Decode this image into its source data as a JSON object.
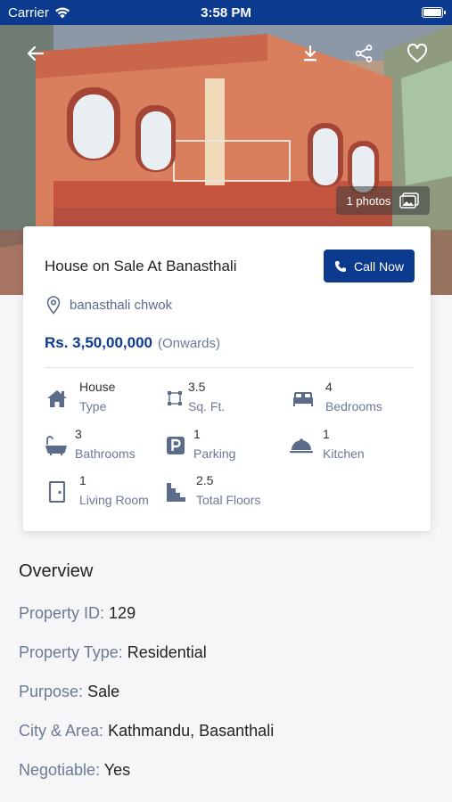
{
  "status_bar": {
    "carrier": "Carrier",
    "time": "3:58 PM"
  },
  "hero": {
    "photo_count": "1 photos"
  },
  "listing": {
    "title": "House on Sale At Banasthali",
    "call_label": "Call Now",
    "location": "banasthali chwok",
    "price": "Rs. 3,50,00,000",
    "price_suffix": "(Onwards)"
  },
  "specs": [
    {
      "value": "House",
      "label": "Type",
      "icon": "house-icon"
    },
    {
      "value": "3.5",
      "label": "Sq. Ft.",
      "icon": "area-icon"
    },
    {
      "value": "4",
      "label": "Bedrooms",
      "icon": "bed-icon"
    },
    {
      "value": "3",
      "label": "Bathrooms",
      "icon": "bathtub-icon"
    },
    {
      "value": "1",
      "label": "Parking",
      "icon": "parking-icon"
    },
    {
      "value": "1",
      "label": "Kitchen",
      "icon": "cloche-icon"
    },
    {
      "value": "1",
      "label": "Living Room",
      "icon": "door-icon"
    },
    {
      "value": "2.5",
      "label": "Total Floors",
      "icon": "stairs-icon"
    }
  ],
  "overview": {
    "heading": "Overview",
    "rows": [
      {
        "key": "Property ID:",
        "value": "129"
      },
      {
        "key": "Property Type:",
        "value": "Residential"
      },
      {
        "key": "Purpose:",
        "value": "Sale"
      },
      {
        "key": "City & Area:",
        "value": "Kathmandu, Basanthali"
      },
      {
        "key": "Negotiable:",
        "value": "Yes"
      }
    ]
  },
  "colors": {
    "primary": "#0c3a8e",
    "muted": "#6b7a93",
    "icon": "#5b6b8a"
  }
}
